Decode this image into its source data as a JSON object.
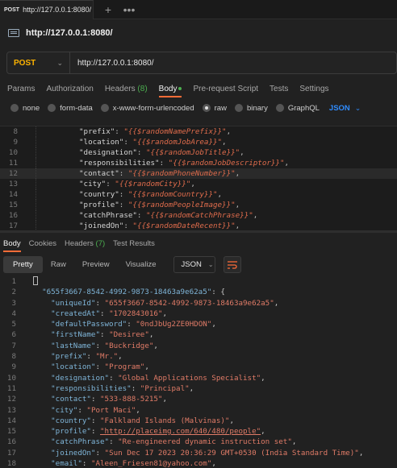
{
  "tab": {
    "method": "POST",
    "url": "http://127.0.0.1:8080/"
  },
  "title": "http://127.0.0.1:8080/",
  "request": {
    "method": "POST",
    "url": "http://127.0.0.1:8080/"
  },
  "request_tabs": [
    {
      "label": "Params"
    },
    {
      "label": "Authorization"
    },
    {
      "label": "Headers",
      "count": "(8)"
    },
    {
      "label": "Body"
    },
    {
      "label": "Pre-request Script"
    },
    {
      "label": "Tests"
    },
    {
      "label": "Settings"
    }
  ],
  "body_options": [
    "none",
    "form-data",
    "x-www-form-urlencoded",
    "raw",
    "binary",
    "GraphQL"
  ],
  "body_format": "JSON",
  "editor_lines": [
    {
      "n": "8",
      "key": "\"prefix\"",
      "val": "\"{{$randomNamePrefix}}\""
    },
    {
      "n": "9",
      "key": "\"location\"",
      "val": "\"{{$randomJobArea}}\""
    },
    {
      "n": "10",
      "key": "\"designation\"",
      "val": "\"{{$randomJobTitle}}\""
    },
    {
      "n": "11",
      "key": "\"responsibilities\"",
      "val": "\"{{$randomJobDescriptor}}\""
    },
    {
      "n": "12",
      "key": "\"contact\"",
      "val": "\"{{$randomPhoneNumber}}\""
    },
    {
      "n": "13",
      "key": "\"city\"",
      "val": "\"{{$randomCity}}\""
    },
    {
      "n": "14",
      "key": "\"country\"",
      "val": "\"{{$randomCountry}}\""
    },
    {
      "n": "15",
      "key": "\"profile\"",
      "val": "\"{{$randomPeopleImage}}\""
    },
    {
      "n": "16",
      "key": "\"catchPhrase\"",
      "val": "\"{{$randomCatchPhrase}}\""
    },
    {
      "n": "17",
      "key": "\"joinedOn\"",
      "val": "\"{{$randomDateRecent}}\""
    }
  ],
  "response_tabs": [
    {
      "label": "Body"
    },
    {
      "label": "Cookies"
    },
    {
      "label": "Headers",
      "count": "(7)"
    },
    {
      "label": "Test Results"
    }
  ],
  "view_modes": [
    "Pretty",
    "Raw",
    "Preview",
    "Visualize"
  ],
  "response_format": "JSON",
  "response_lines": [
    {
      "n": "1",
      "text": "{"
    },
    {
      "n": "2",
      "text": ""
    },
    {
      "n": "3",
      "key": "\"655f3667-8542-4992-9873-18463a9e62a5\"",
      "sep": ": {"
    },
    {
      "n": "3",
      "key": "\"uniqueId\"",
      "val": "\"655f3667-8542-4992-9873-18463a9e62a5\""
    },
    {
      "n": "4",
      "key": "\"createdAt\"",
      "val": "\"1702843016\""
    },
    {
      "n": "5",
      "key": "\"defaultPassword\"",
      "val": "\"0ndJbUg2ZE0HDON\""
    },
    {
      "n": "6",
      "key": "\"firstName\"",
      "val": "\"Desiree\""
    },
    {
      "n": "7",
      "key": "\"lastName\"",
      "val": "\"Buckridge\""
    },
    {
      "n": "8",
      "key": "\"prefix\"",
      "val": "\"Mr.\""
    },
    {
      "n": "9",
      "key": "\"location\"",
      "val": "\"Program\""
    },
    {
      "n": "10",
      "key": "\"designation\"",
      "val": "\"Global Applications Specialist\""
    },
    {
      "n": "11",
      "key": "\"responsibilities\"",
      "val": "\"Principal\""
    },
    {
      "n": "12",
      "key": "\"contact\"",
      "val": "\"533-888-5215\""
    },
    {
      "n": "13",
      "key": "\"city\"",
      "val": "\"Port Maci\""
    },
    {
      "n": "14",
      "key": "\"country\"",
      "val": "\"Falkland Islands (Malvinas)\""
    },
    {
      "n": "15",
      "key": "\"profile\"",
      "link": "\"http://placeimg.com/640/480/people\""
    },
    {
      "n": "16",
      "key": "\"catchPhrase\"",
      "val": "\"Re-engineered dynamic instruction set\""
    },
    {
      "n": "17",
      "key": "\"joinedOn\"",
      "val": "\"Sun Dec 17 2023 20:36:29 GMT+0530 (India Standard Time)\""
    },
    {
      "n": "18",
      "key": "\"email\"",
      "val": "\"Aleen_Friesen81@yahoo.com\""
    }
  ]
}
